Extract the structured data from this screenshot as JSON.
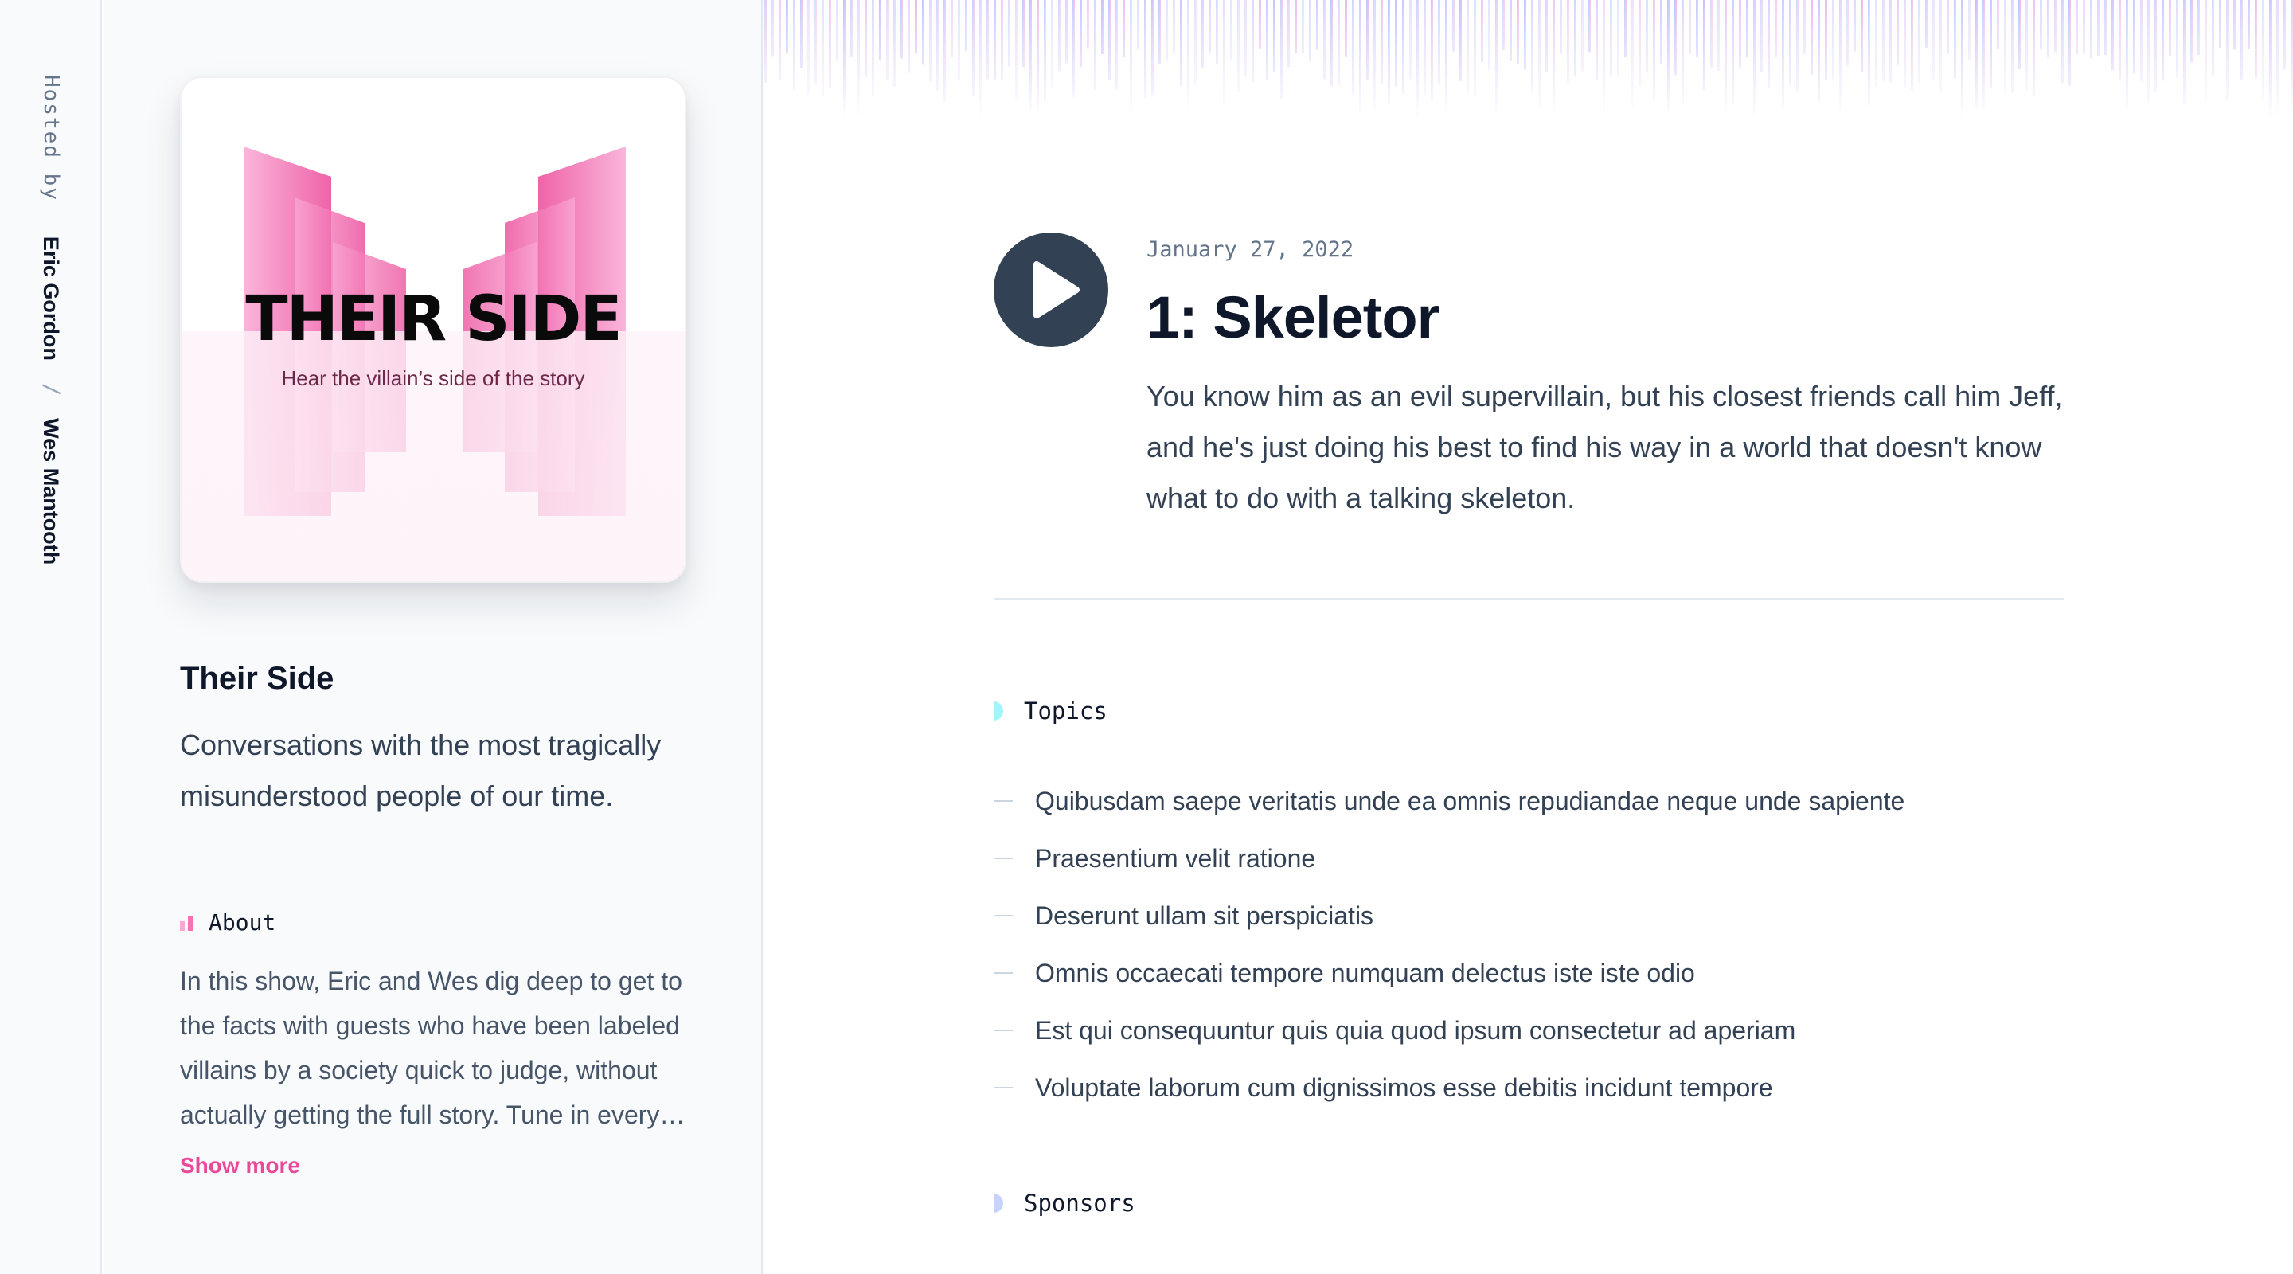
{
  "rail": {
    "hosted_by": "Hosted by",
    "hosts": [
      "Eric Gordon",
      "Wes Mantooth"
    ],
    "separator": "/"
  },
  "podcast": {
    "cover": {
      "title": "THEIR SIDE",
      "subtitle": "Hear the villain’s side of the story"
    },
    "title": "Their Side",
    "description": "Conversations with the most tragically misunderstood people of our time.",
    "about": {
      "heading": "About",
      "text": "In this show, Eric and Wes dig deep to get to the facts with guests who have been labeled villains by a society quick to judge, without actually getting the full story. Tune in every…",
      "show_more": "Show more"
    }
  },
  "episode": {
    "date": "January 27, 2022",
    "title": "1: Skeletor",
    "description": "You know him as an evil supervillain, but his closest friends call him Jeff, and he's just doing his best to find his way in a world that doesn't know what to do with a talking skeleton.",
    "play_icon": "play-icon"
  },
  "sections": {
    "topics": {
      "heading": "Topics",
      "items": [
        "Quibusdam saepe veritatis unde ea omnis repudiandae neque unde sapiente",
        "Praesentium velit ratione",
        "Deserunt ullam sit perspiciatis",
        "Omnis occaecati tempore numquam delectus iste iste odio",
        "Est qui consequuntur quis quia quod ipsum consectetur ad aperiam",
        "Voluptate laborum cum dignissimos esse debitis incidunt tempore"
      ]
    },
    "sponsors": {
      "heading": "Sponsors"
    }
  },
  "colors": {
    "accent": "#ec4899",
    "play_button": "#334155",
    "topics_marker": "#a5f3fc",
    "sponsors_marker": "#c7d2fe"
  }
}
